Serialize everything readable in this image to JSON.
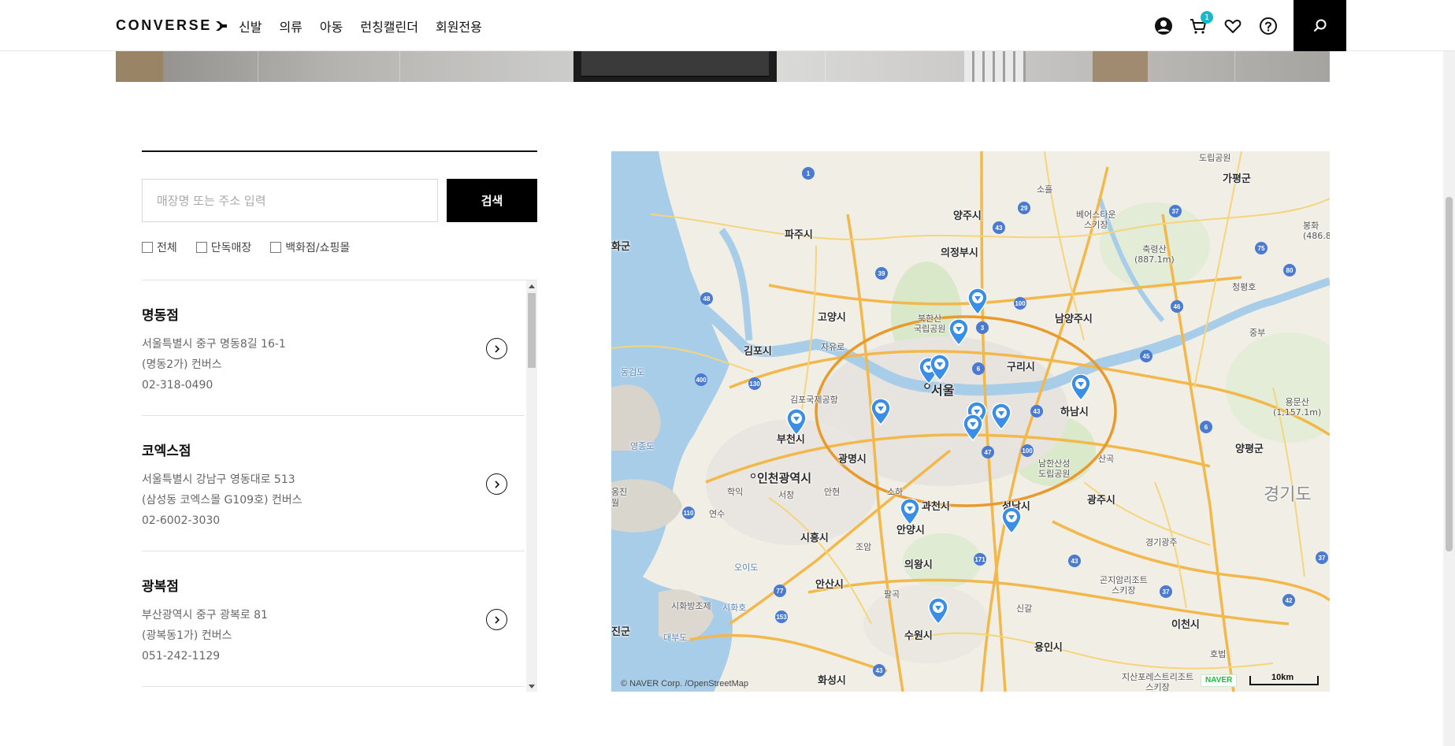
{
  "header": {
    "logo_text": "CONVERSE",
    "nav": [
      "신발",
      "의류",
      "아동",
      "런칭캘린더",
      "회원전용"
    ],
    "cart_count": "1"
  },
  "search": {
    "placeholder": "매장명 또는 주소 입력",
    "button_label": "검색"
  },
  "filters": [
    {
      "label": "전체",
      "checked": false
    },
    {
      "label": "단독매장",
      "checked": false
    },
    {
      "label": "백화점/쇼핑몰",
      "checked": false
    }
  ],
  "stores": [
    {
      "name": "명동점",
      "address_line1": "서울특별시 중구 명동8길 16-1",
      "address_line2": "(명동2가) 컨버스",
      "phone": "02-318-0490"
    },
    {
      "name": "코엑스점",
      "address_line1": "서울특별시 강남구 영동대로 513",
      "address_line2": "(삼성동 코엑스몰 G109호) 컨버스",
      "phone": "02-6002-3030"
    },
    {
      "name": "광복점",
      "address_line1": "부산광역시 중구 광복로 81",
      "address_line2": "(광복동1가) 컨버스",
      "phone": "051-242-1129"
    }
  ],
  "map": {
    "labels": {
      "seoul": "서울",
      "incheon": "인천광역시",
      "goyang": "고양시",
      "gimpo": "김포시",
      "paju": "파주시",
      "yangju": "양주시",
      "uijeongbu": "의정부시",
      "namyangju": "남양주시",
      "guri": "구리시",
      "hanam": "하남시",
      "bucheon": "부천시",
      "gwangmyeong": "광명시",
      "siheung": "시흥시",
      "anyang": "안양시",
      "gwacheon": "과천시",
      "seongnam": "성남시",
      "gwangju": "광주시",
      "uiwang": "의왕시",
      "ansan": "안산시",
      "suwon": "수원시",
      "yongin": "용인시",
      "icheon": "이천시",
      "hwaseong": "화성시",
      "gapyeong": "가평군",
      "yangpyeong": "양평군",
      "gyeonggi": "경기도",
      "gimpo_airport": "김포국제공항",
      "bukhansan": "북한산\n국립공원",
      "yeongjongdo": "영종도",
      "ganghwa": "화군",
      "ongjin": "옹진\n월",
      "jin": "진군",
      "daebudo": "대부도",
      "oido": "오이도",
      "sihwa": "시화호",
      "sihwa_dam": "시화방조제",
      "namhansanseong": "남한산성\n도립공원",
      "dongdo": "동검도",
      "jayuro": "자유로",
      "soheul": "소흘",
      "hakik": "학익",
      "seochang": "서창",
      "anhyeon": "안현",
      "soha": "소하",
      "joam": "조암",
      "palgok": "팔곡",
      "singal": "신갈",
      "hogbeop": "호법",
      "sangok": "산곡",
      "yeonsu": "연수",
      "gyeonggi_gwangju": "경기광주",
      "jungbu": "중부",
      "chugryeong": "축령산\n(887.1m)",
      "yongmun": "용문산\n(1,157.1m)",
      "bears": "베어스타운\n스키장",
      "gonjiam": "곤지암리조트\n스키장",
      "jisan": "지산포레스트리조트\n스키장",
      "cheongpyeong": "청평호",
      "dorip": "도립공원",
      "bonghwa": "봉화\n(486.8"
    },
    "attribution": "© NAVER Corp. /OpenStreetMap",
    "naver": "NAVER",
    "scale": "10km"
  }
}
